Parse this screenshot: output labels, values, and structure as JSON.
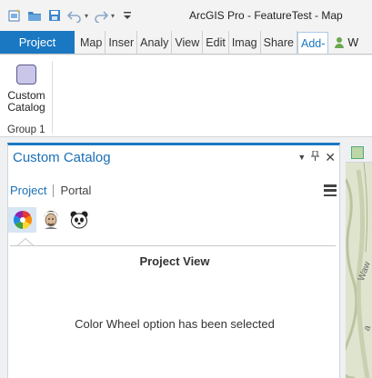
{
  "window": {
    "title": "ArcGIS Pro - FeatureTest - Map"
  },
  "ribbon_tabs": {
    "project": "Project",
    "items": [
      "Map",
      "Inser",
      "Analy",
      "View",
      "Edit",
      "Imag",
      "Share",
      "Add-"
    ],
    "active": "Add-",
    "user_initial": "W"
  },
  "ribbon": {
    "button_label": "Custom\nCatalog",
    "group_label": "Group 1"
  },
  "pane": {
    "title": "Custom Catalog",
    "tabs": {
      "active": "Project",
      "other": "Portal"
    },
    "icons": [
      "color-wheel-icon",
      "person-icon",
      "panda-icon"
    ],
    "view_title": "Project View",
    "message": "Color Wheel option has been selected"
  },
  "map_edge": {
    "label_1": "Waw",
    "label_2": "a"
  },
  "colors": {
    "accent": "#1a78c2",
    "selected_bg": "#d7e6f4"
  }
}
